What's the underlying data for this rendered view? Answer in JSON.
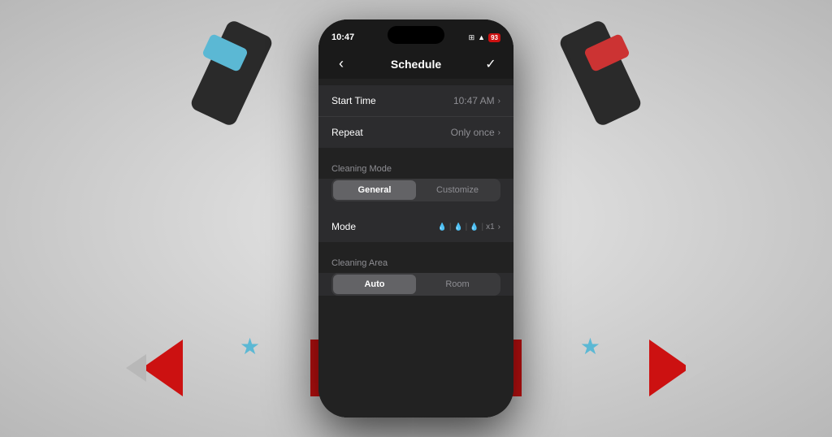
{
  "background": {
    "color": "#d0d0d0"
  },
  "phone": {
    "statusBar": {
      "time": "10:47",
      "battery": "93",
      "batteryColor": "#cc1111"
    },
    "navBar": {
      "title": "Schedule",
      "backIcon": "‹",
      "checkIcon": "✓"
    },
    "sections": [
      {
        "id": "time-repeat",
        "rows": [
          {
            "label": "Start Time",
            "value": "10:47 AM",
            "hasChevron": true
          },
          {
            "label": "Repeat",
            "value": "Only once",
            "hasChevron": true
          }
        ]
      },
      {
        "id": "cleaning-mode",
        "header": "Cleaning Mode",
        "segmentOptions": [
          "General",
          "Customize"
        ],
        "activeSegment": 0,
        "rows": [
          {
            "label": "Mode",
            "value": "💧 | 💧 | 💧 | x1",
            "hasChevron": true
          }
        ]
      },
      {
        "id": "cleaning-area",
        "header": "Cleaning Area",
        "segmentOptions": [
          "Auto",
          "Room"
        ],
        "activeSegment": 0
      }
    ]
  }
}
